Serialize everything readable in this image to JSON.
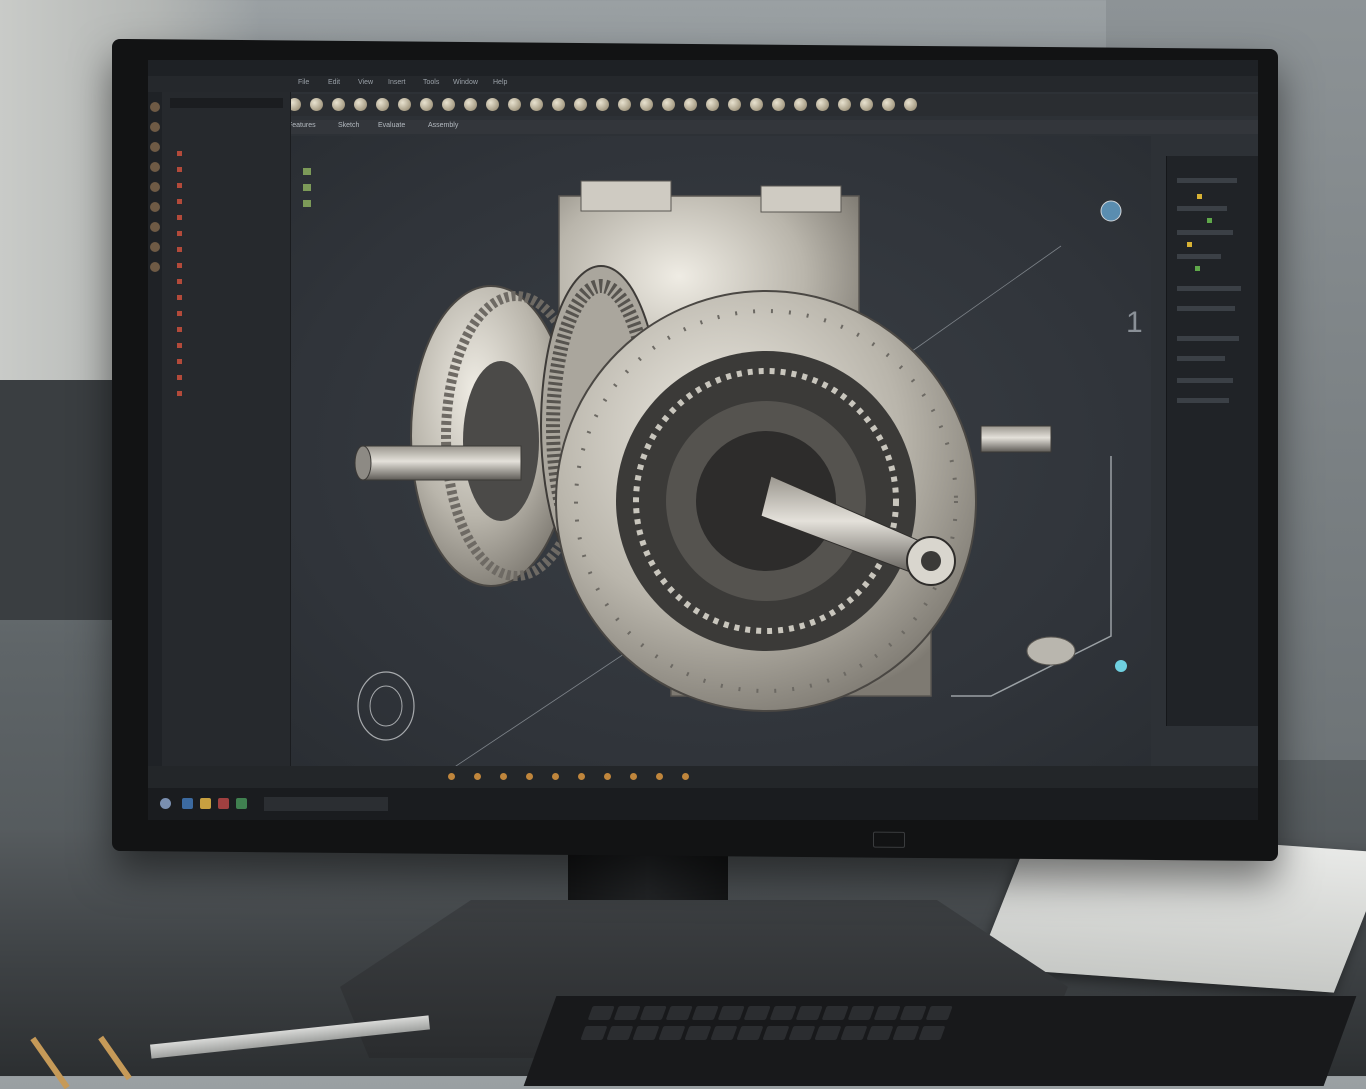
{
  "app": {
    "title": "",
    "menus": [
      "File",
      "Edit",
      "View",
      "Insert",
      "Tools",
      "Window",
      "Help"
    ],
    "ribbon_tabs": [
      "Features",
      "Sketch",
      "Evaluate",
      "Assembly"
    ],
    "search_placeholder": ""
  },
  "tree_panel": {
    "header": "",
    "items": [
      "",
      "",
      "",
      "",
      "",
      "",
      "",
      "",
      "",
      "",
      "",
      "",
      "",
      "",
      "",
      ""
    ]
  },
  "viewport": {
    "overlay_items": [
      "",
      "",
      "",
      ""
    ],
    "view_label": "",
    "axis_marker": "1",
    "model": "gearbox-assembly"
  },
  "right_panel": {
    "title": ""
  },
  "status_bar": {
    "text": ""
  },
  "taskbar": {
    "search_placeholder": ""
  },
  "colors": {
    "viewport_bg": "#30343a",
    "panel_bg": "#26292d",
    "accent_orange": "#c0863c",
    "accent_yellow": "#d8b234",
    "accent_green": "#5fa84a",
    "model_metal": "#c9c6bd"
  }
}
